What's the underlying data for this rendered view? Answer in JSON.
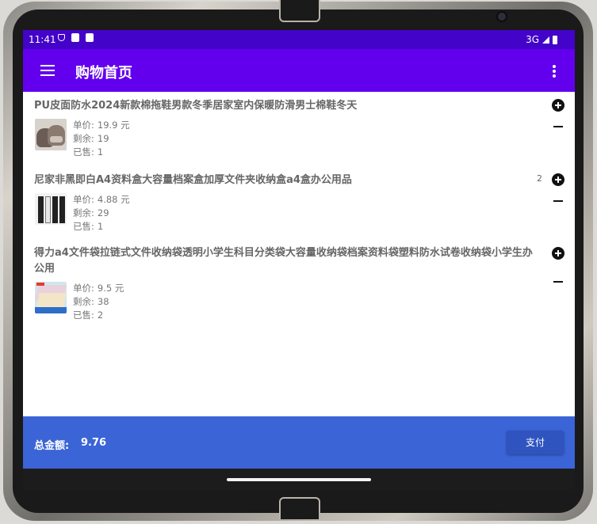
{
  "status_bar": {
    "time": "11:41",
    "network": "3G"
  },
  "app_bar": {
    "title": "购物首页",
    "menu_icon": "hamburger-menu-icon",
    "overflow_icon": "more-vert-icon"
  },
  "products": [
    {
      "title": "PU皮面防水2024新款棉拖鞋男款冬季居家室内保暖防滑男士棉鞋冬天",
      "price_label": "单价:",
      "price": "19.9 元",
      "remaining_label": "剩余:",
      "remaining": "19",
      "sold_label": "已售:",
      "sold": "1",
      "quantity": "",
      "thumbnail": "slipper-image"
    },
    {
      "title": "尼家非黑即白A4资料盒大容量档案盒加厚文件夹收纳盒a4盒办公用品",
      "price_label": "单价:",
      "price": "4.88 元",
      "remaining_label": "剩余:",
      "remaining": "29",
      "sold_label": "已售:",
      "sold": "1",
      "quantity": "2",
      "thumbnail": "file-box-image"
    },
    {
      "title": "得力a4文件袋拉链式文件收纳袋透明小学生科目分类袋大容量收纳袋档案资料袋塑料防水试卷收纳袋小学生办公用",
      "price_label": "单价:",
      "price": "9.5 元",
      "remaining_label": "剩余:",
      "remaining": "38",
      "sold_label": "已售:",
      "sold": "2",
      "quantity": "",
      "thumbnail": "file-bag-image"
    }
  ],
  "bottom_bar": {
    "total_label": "总金额:",
    "total_value": "9.76",
    "pay_label": "支付"
  },
  "colors": {
    "status_bar": "#4303c9",
    "app_bar": "#6200ee",
    "bottom_bar": "#3b64d6",
    "pay_button": "#2f54bf"
  }
}
